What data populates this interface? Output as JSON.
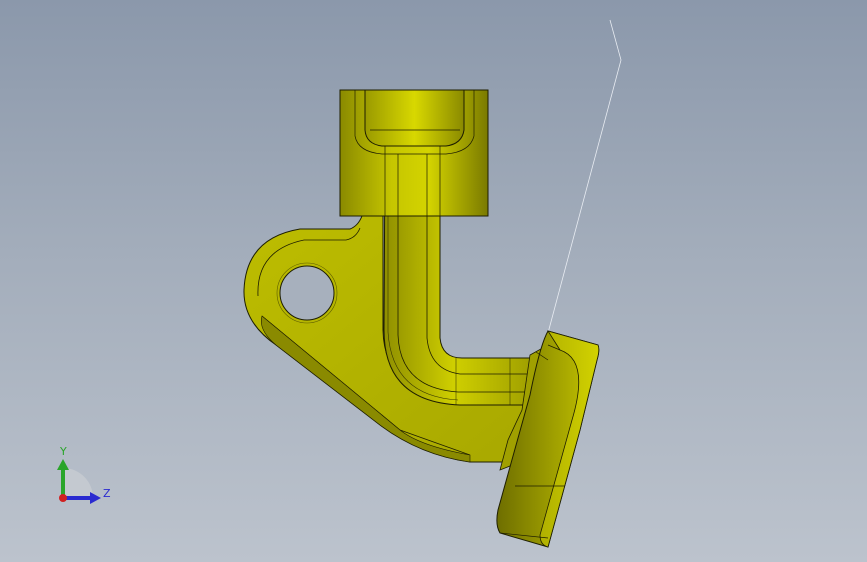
{
  "viewport": {
    "background_top": "#8b98ab",
    "background_bottom": "#bcc3cd",
    "part_color": "#c8c800",
    "edge_color": "#1e1e00"
  },
  "triad": {
    "y_label": "Y",
    "z_label": "Z",
    "y_color": "#2aa52a",
    "z_color": "#2a2ad0",
    "x_color": "#d02020"
  }
}
